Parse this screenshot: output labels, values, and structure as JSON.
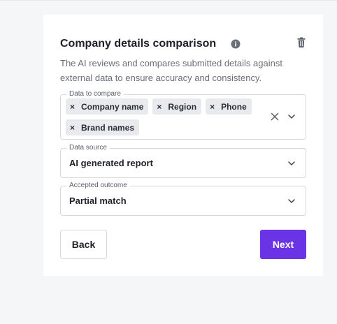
{
  "card": {
    "title": "Company details comparison",
    "description": "The AI reviews and compares submitted details against external data to ensure accuracy and consistency."
  },
  "fields": {
    "data_to_compare": {
      "label": "Data to compare",
      "chips": [
        {
          "remove": "×",
          "label": "Company name"
        },
        {
          "remove": "×",
          "label": "Region"
        },
        {
          "remove": "×",
          "label": "Phone"
        },
        {
          "remove": "×",
          "label": "Brand names"
        }
      ]
    },
    "data_source": {
      "label": "Data source",
      "value": "AI generated report"
    },
    "accepted_outcome": {
      "label": "Accepted outcome",
      "value": "Partial match"
    }
  },
  "actions": {
    "back_label": "Back",
    "next_label": "Next"
  },
  "colors": {
    "accent": "#6a34e6",
    "chip_bg": "#e9eaee",
    "border": "#d6d8de",
    "muted_text": "#6b6f78"
  },
  "icons": {
    "info": "info-icon",
    "delete": "trash-icon",
    "clear": "close-icon",
    "expand": "chevron-down-icon"
  }
}
